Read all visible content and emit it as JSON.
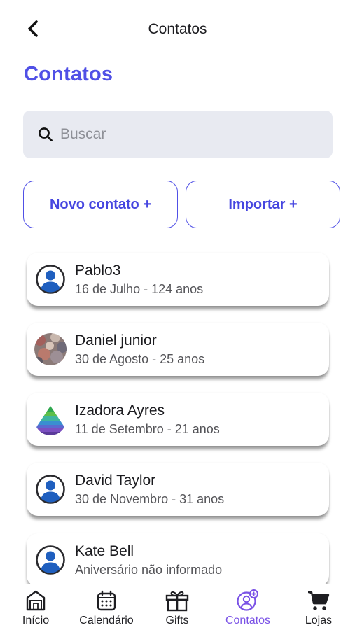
{
  "header": {
    "title": "Contatos",
    "back_icon": "chevron-left-icon"
  },
  "page_title": "Contatos",
  "search": {
    "placeholder": "Buscar",
    "value": "",
    "icon": "search-icon"
  },
  "actions": {
    "new_contact": "Novo contato +",
    "import": "Importar +"
  },
  "contacts": [
    {
      "name": "Pablo3",
      "subtitle": "16 de Julho - 124 anos",
      "avatar": "default-user-icon"
    },
    {
      "name": "Daniel junior",
      "subtitle": "30 de Agosto - 25 anos",
      "avatar": "photo"
    },
    {
      "name": "Izadora Ayres",
      "subtitle": "11 de Setembro - 21 anos",
      "avatar": "rainbow-pyramid-image"
    },
    {
      "name": "David Taylor",
      "subtitle": "30 de Novembro - 31 anos",
      "avatar": "default-user-icon"
    },
    {
      "name": "Kate Bell",
      "subtitle": "Aniversário não informado",
      "avatar": "default-user-icon"
    }
  ],
  "tabbar": {
    "active": "contatos",
    "items": [
      {
        "label": "Início",
        "icon": "home-icon"
      },
      {
        "label": "Calendário",
        "icon": "calendar-icon"
      },
      {
        "label": "Gifts",
        "icon": "gift-icon"
      },
      {
        "label": "Contatos",
        "icon": "contacts-add-icon"
      },
      {
        "label": "Lojas",
        "icon": "cart-icon"
      }
    ]
  },
  "colors": {
    "accent": "#5050e6",
    "active_tab": "#7a52e6",
    "search_bg": "#e8eaf1",
    "avatar_blue": "#1f5fbf"
  }
}
